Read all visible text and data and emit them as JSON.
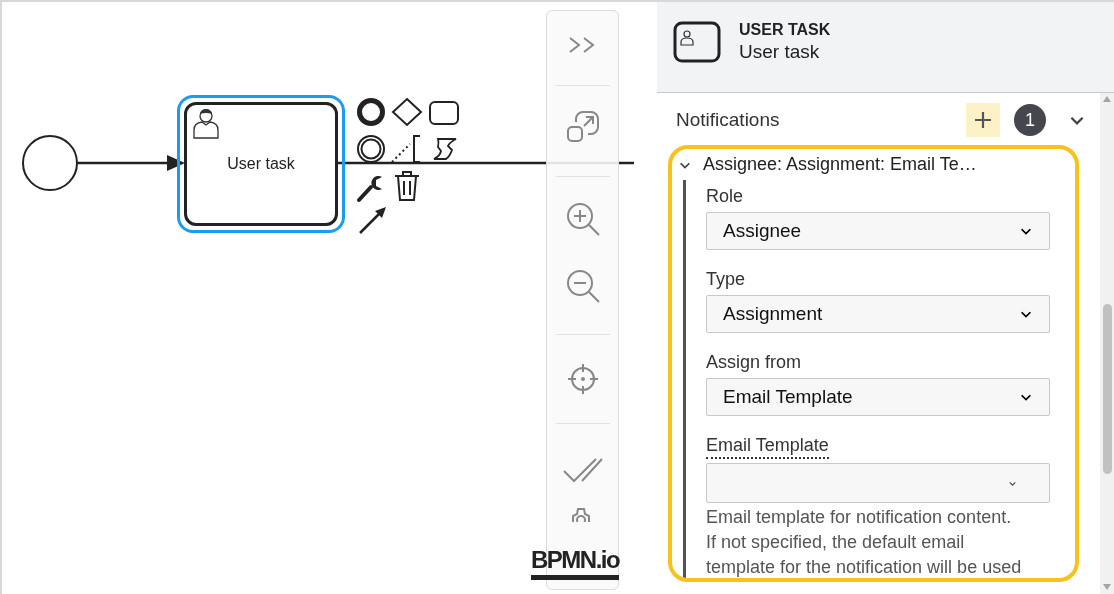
{
  "canvas": {
    "task": {
      "label": "User task",
      "selected": true
    }
  },
  "logo": "BPMN.io",
  "properties": {
    "header": {
      "type": "USER TASK",
      "name": "User task"
    },
    "group": {
      "title": "Notifications",
      "count": "1",
      "expanded": true,
      "items": [
        {
          "title": "Assignee: Assignment: Email Te…",
          "expanded": true,
          "highlighted": true,
          "fields": [
            {
              "kind": "select",
              "label": "Role",
              "value": "Assignee"
            },
            {
              "kind": "select",
              "label": "Type",
              "value": "Assignment"
            },
            {
              "kind": "select",
              "label": "Assign from",
              "value": "Email Template"
            },
            {
              "kind": "combo",
              "label": "Email Template",
              "description": "Email template for notification content. If not specified, the default email template for the notification will be used"
            }
          ]
        }
      ]
    }
  }
}
